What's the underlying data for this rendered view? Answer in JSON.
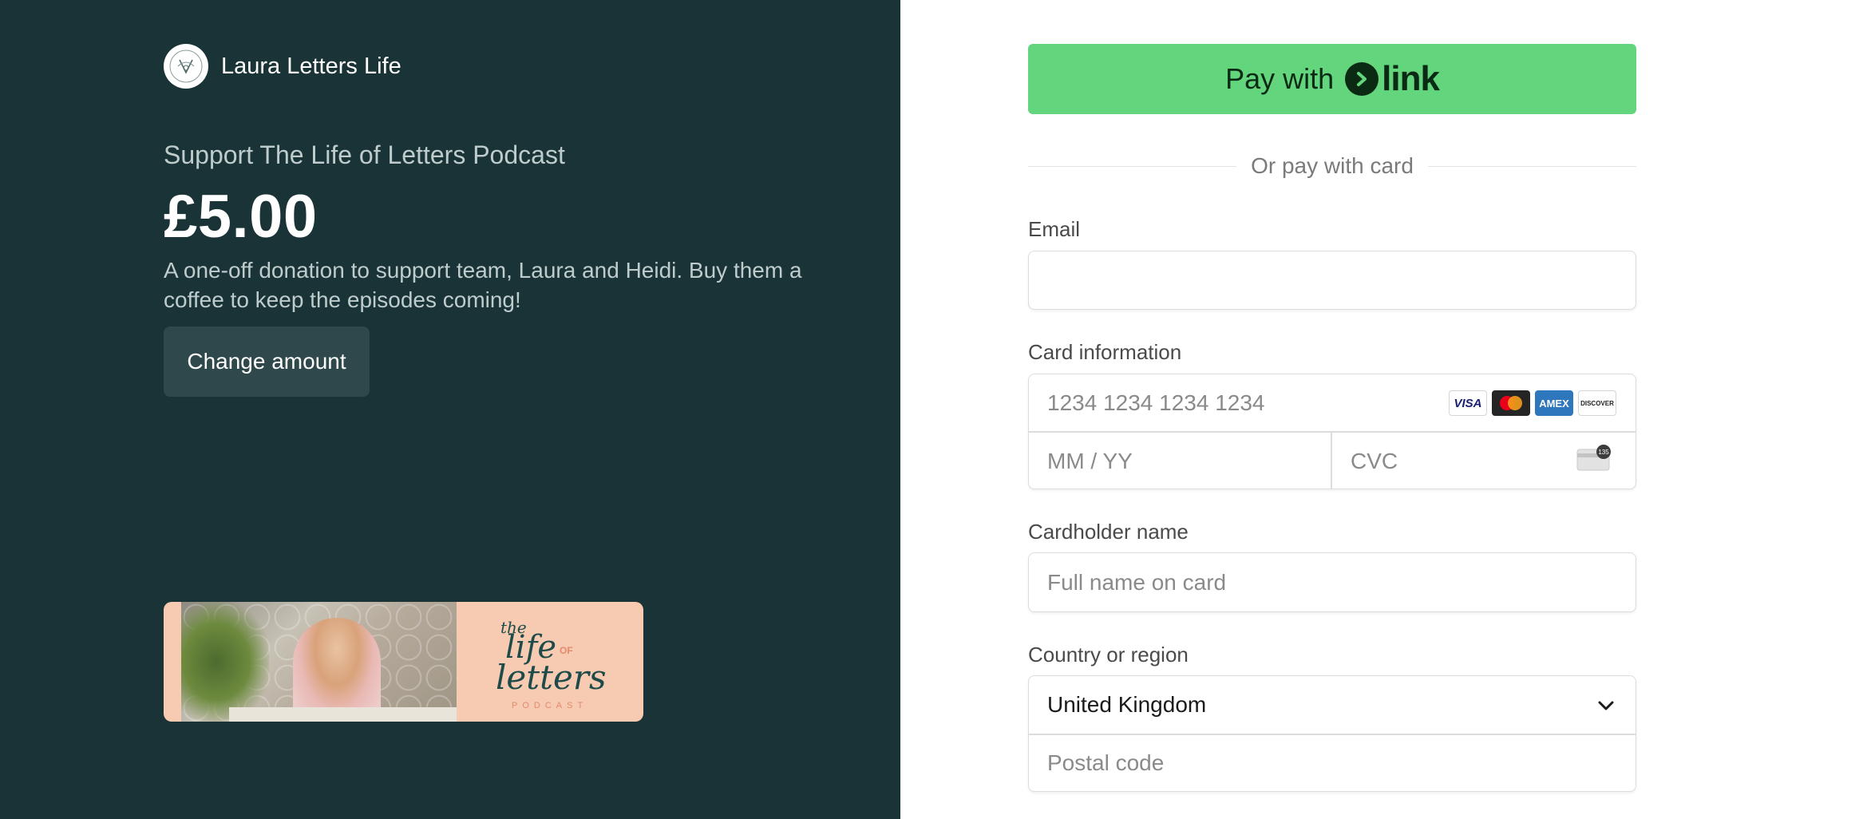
{
  "merchant": {
    "name": "Laura Letters Life"
  },
  "product": {
    "name": "Support The Life of Letters Podcast",
    "amount": "£5.00",
    "description": "A one-off donation to support team, Laura and Heidi. Buy them a coffee to keep the episodes coming!",
    "change_amount_label": "Change amount",
    "banner": {
      "logo_the": "the",
      "logo_life": "life",
      "logo_of": "OF",
      "logo_letters": "letters",
      "logo_podcast": "PODCAST"
    }
  },
  "payment": {
    "link_button": {
      "pay_with": "Pay with",
      "link_word": "link"
    },
    "divider_text": "Or pay with card",
    "email": {
      "label": "Email",
      "value": "",
      "placeholder": ""
    },
    "card": {
      "label": "Card information",
      "number_placeholder": "1234 1234 1234 1234",
      "expiry_placeholder": "MM / YY",
      "cvc_placeholder": "CVC",
      "brands": [
        "VISA",
        "mastercard",
        "AMEX",
        "DISCOVER"
      ],
      "cvc_hint": "135"
    },
    "cardholder": {
      "label": "Cardholder name",
      "placeholder": "Full name on card"
    },
    "country": {
      "label": "Country or region",
      "selected": "United Kingdom",
      "postal_placeholder": "Postal code"
    }
  },
  "colors": {
    "left_panel_bg": "#193337",
    "link_green": "#63d57c",
    "button_dark": "#2e484c"
  }
}
